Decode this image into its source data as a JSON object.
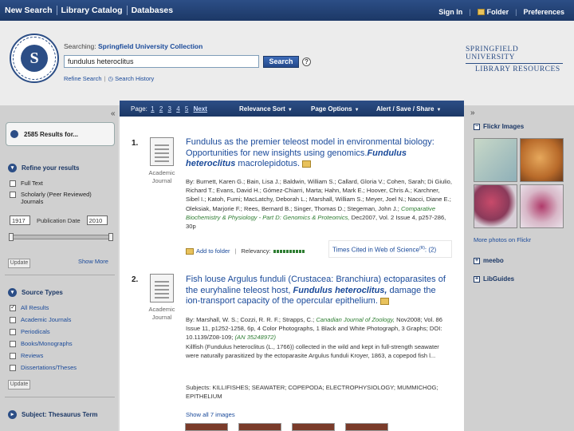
{
  "topnav": {
    "items": [
      "New Search",
      "Library Catalog",
      "Databases"
    ],
    "right": [
      "Sign In",
      "Folder",
      "Preferences"
    ]
  },
  "header": {
    "searching_prefix": "Searching:",
    "collection": "Springfield University Collection",
    "query": "fundulus heteroclitus",
    "search_button": "Search",
    "help": "?",
    "refine_search": "Refine Search",
    "search_history": "Search History",
    "library_logo_line1": "SPRINGFIELD UNIVERSITY",
    "library_logo_line2": "LIBRARY RESOURCES",
    "seal_letter": "S"
  },
  "left": {
    "collapse": "«",
    "results_count": "2585 Results for...",
    "refine_heading": "Refine your results",
    "refine_options": [
      {
        "label": "Full Text",
        "checked": false
      },
      {
        "label": "Scholarly (Peer Reviewed) Journals",
        "checked": false
      }
    ],
    "date_from": "1917",
    "date_label": "Publication Date",
    "date_to": "2010",
    "update_label": "Update",
    "show_more": "Show More",
    "source_types_heading": "Source Types",
    "source_types": [
      {
        "label": "All Results",
        "checked": true
      },
      {
        "label": "Academic Journals",
        "checked": false
      },
      {
        "label": "Periodicals",
        "checked": false
      },
      {
        "label": "Books/Monographs",
        "checked": false
      },
      {
        "label": "Reviews",
        "checked": false
      },
      {
        "label": "Dissertations/Theses",
        "checked": false
      }
    ],
    "subject_heading": "Subject: Thesaurus Term"
  },
  "toolbar": {
    "page_label": "Page:",
    "pages": [
      "1",
      "2",
      "3",
      "4",
      "5"
    ],
    "next": "Next",
    "relevance_sort": "Relevance Sort",
    "page_options": "Page Options",
    "alert_save_share": "Alert / Save / Share",
    "chev": "▼"
  },
  "results": [
    {
      "number": "1.",
      "doc_type": "Academic Journal",
      "title_plain": "Fundulus as the premier teleost model in environmental biology: Opportunities for new insights using genomics.",
      "title_italic_1": "Fundulus",
      "title_italic_2": "heteroclitus",
      "title_tail": " macrolepidotus.",
      "authors": "By: Burnett, Karen G.; Bain, Lisa J.; Baldwin, William S.; Callard, Gloria V.; Cohen, Sarah; Di Giulio, Richard T.; Evans, David H.; Gómez-Chiarri, Marta; Hahn, Mark E.; Hoover, Chris A.; Karchner, Sibel I.; Katoh, Fumi; MacLatchy, Deborah L.; Marshall, William S.; Meyer, Joel N.; Nacci, Diane E.; Oleksiak, Marjorie F.; Rees, Bernard B.; Singer, Thomas D.; Stegeman, John J.;",
      "journal": "Comparative Biochemistry & Physiology - Part D: Genomics & Proteomics,",
      "pubinfo": " Dec2007, Vol. 2 Issue 4, p257-286, 30p",
      "add_to_folder": "Add to folder",
      "relevancy_label": "Relevancy:",
      "times_cited": "Times Cited in Web of Science",
      "times_cited_sup": "(R)",
      "times_cited_count": ": (2)"
    },
    {
      "number": "2.",
      "doc_type": "Academic Journal",
      "title_plain": "Fish louse Argulus funduli (Crustacea: Branchiura) ectoparasites of the euryhaline teleost host, ",
      "title_italic_1": "Fundulus heteroclitus,",
      "title_tail": " damage the ion-transport capacity of the opercular epithelium.",
      "authors_prefix": "By: Marshall, W. S.; Cozzi, R. R. F.; Strapps, C.;",
      "journal": " Canadian Journal of Zoology,",
      "pubinfo": " Nov2008; Vol. 86 Issue 11, p1252-1258, 6p, 4 Color Photographs, 1 Black and White Photograph, 3 Graphs; DOI: 10.1139/Z08-109;",
      "an": "(AN 35248972)",
      "abstract": "Killfish (Fundulus heteroclitus (L., 1766)) collected in the wild and kept in full-strength seawater were naturally parasitized by the ectoparasite Argulus funduli Kroyer, 1863, a copepod fish l...",
      "subjects": "Subjects: KILLIFISHES; SEAWATER; COPEPODA; ELECTROPHYSIOLOGY; MUMMICHOG; EPITHELIUM",
      "show_images": "Show all 7 images"
    }
  ],
  "right": {
    "arrow": "»",
    "flickr_heading": "Flickr Images",
    "more_photos": "More photos on Flickr",
    "meebo": "meebo",
    "libguides": "LibGuides",
    "plus": "⊟",
    "plus_closed": "⊞"
  }
}
